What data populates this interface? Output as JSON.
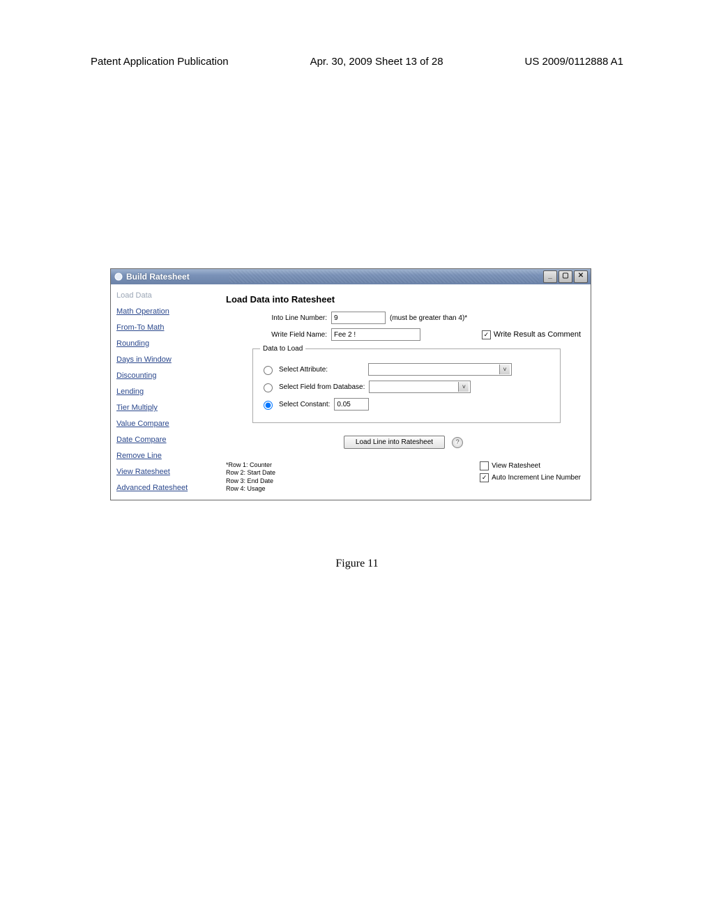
{
  "page_header": {
    "left": "Patent Application Publication",
    "center": "Apr. 30, 2009  Sheet 13 of 28",
    "right": "US 2009/0112888 A1"
  },
  "window": {
    "title": "Build Ratesheet"
  },
  "sidebar": {
    "items": [
      {
        "label": "Load Data",
        "current": true
      },
      {
        "label": "Math Operation"
      },
      {
        "label": "From-To Math"
      },
      {
        "label": "Rounding"
      },
      {
        "label": "Days in Window"
      },
      {
        "label": "Discounting"
      },
      {
        "label": "Lending"
      },
      {
        "label": "Tier Multiply"
      },
      {
        "label": "Value Compare"
      },
      {
        "label": "Date Compare"
      },
      {
        "label": "Remove Line"
      },
      {
        "label": "View Ratesheet"
      },
      {
        "label": "Advanced Ratesheet"
      }
    ]
  },
  "panel": {
    "title": "Load Data into Ratesheet",
    "line_number_label": "Into Line Number:",
    "line_number_value": "9",
    "line_number_hint": "(must be greater than 4)*",
    "field_name_label": "Write Field Name:",
    "field_name_value": "Fee 2 !",
    "write_comment_label": "Write Result as Comment",
    "write_comment_checked": true,
    "fieldset_legend": "Data to Load",
    "radio_attribute_label": "Select Attribute:",
    "radio_database_label": "Select Field from Database:",
    "radio_constant_label": "Select Constant:",
    "constant_value": "0.05",
    "selected_radio": "constant",
    "load_button": "Load Line into Ratesheet"
  },
  "footer": {
    "row_hints": "*Row 1: Counter\nRow 2: Start Date\nRow 3: End Date\nRow 4: Usage",
    "view_ratesheet_label": "View Ratesheet",
    "view_ratesheet_checked": false,
    "auto_increment_label": "Auto Increment Line Number",
    "auto_increment_checked": true
  },
  "figure_caption": "Figure 11"
}
